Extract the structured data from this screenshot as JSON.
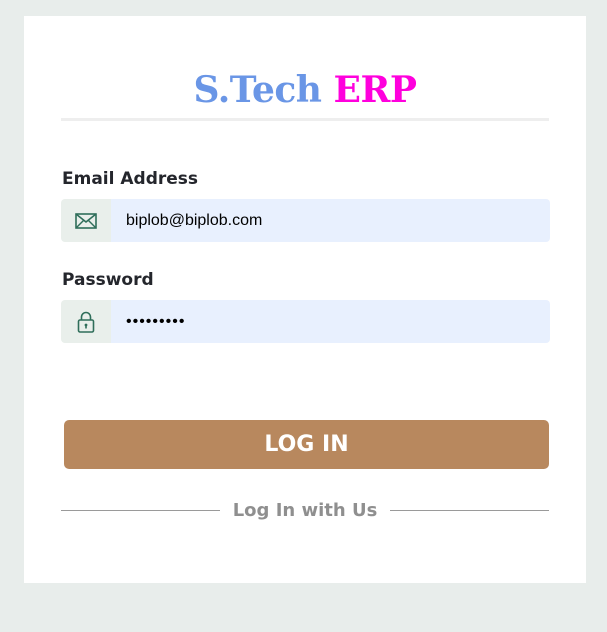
{
  "brand": {
    "part1": "S.Tech",
    "part2": "ERP"
  },
  "form": {
    "email": {
      "label": "Email Address",
      "value": "biplob@biplob.com",
      "icon": "envelope-icon"
    },
    "password": {
      "label": "Password",
      "value": "•••••••••",
      "icon": "lock-icon"
    },
    "submit_label": "LOG IN",
    "separator_text": "Log In with Us"
  },
  "colors": {
    "brand_primary": "#6a96e6",
    "brand_accent": "#ff00dd",
    "button": "#b8885e",
    "input_background": "#e8f0fe",
    "page_background": "#e8edeb"
  }
}
